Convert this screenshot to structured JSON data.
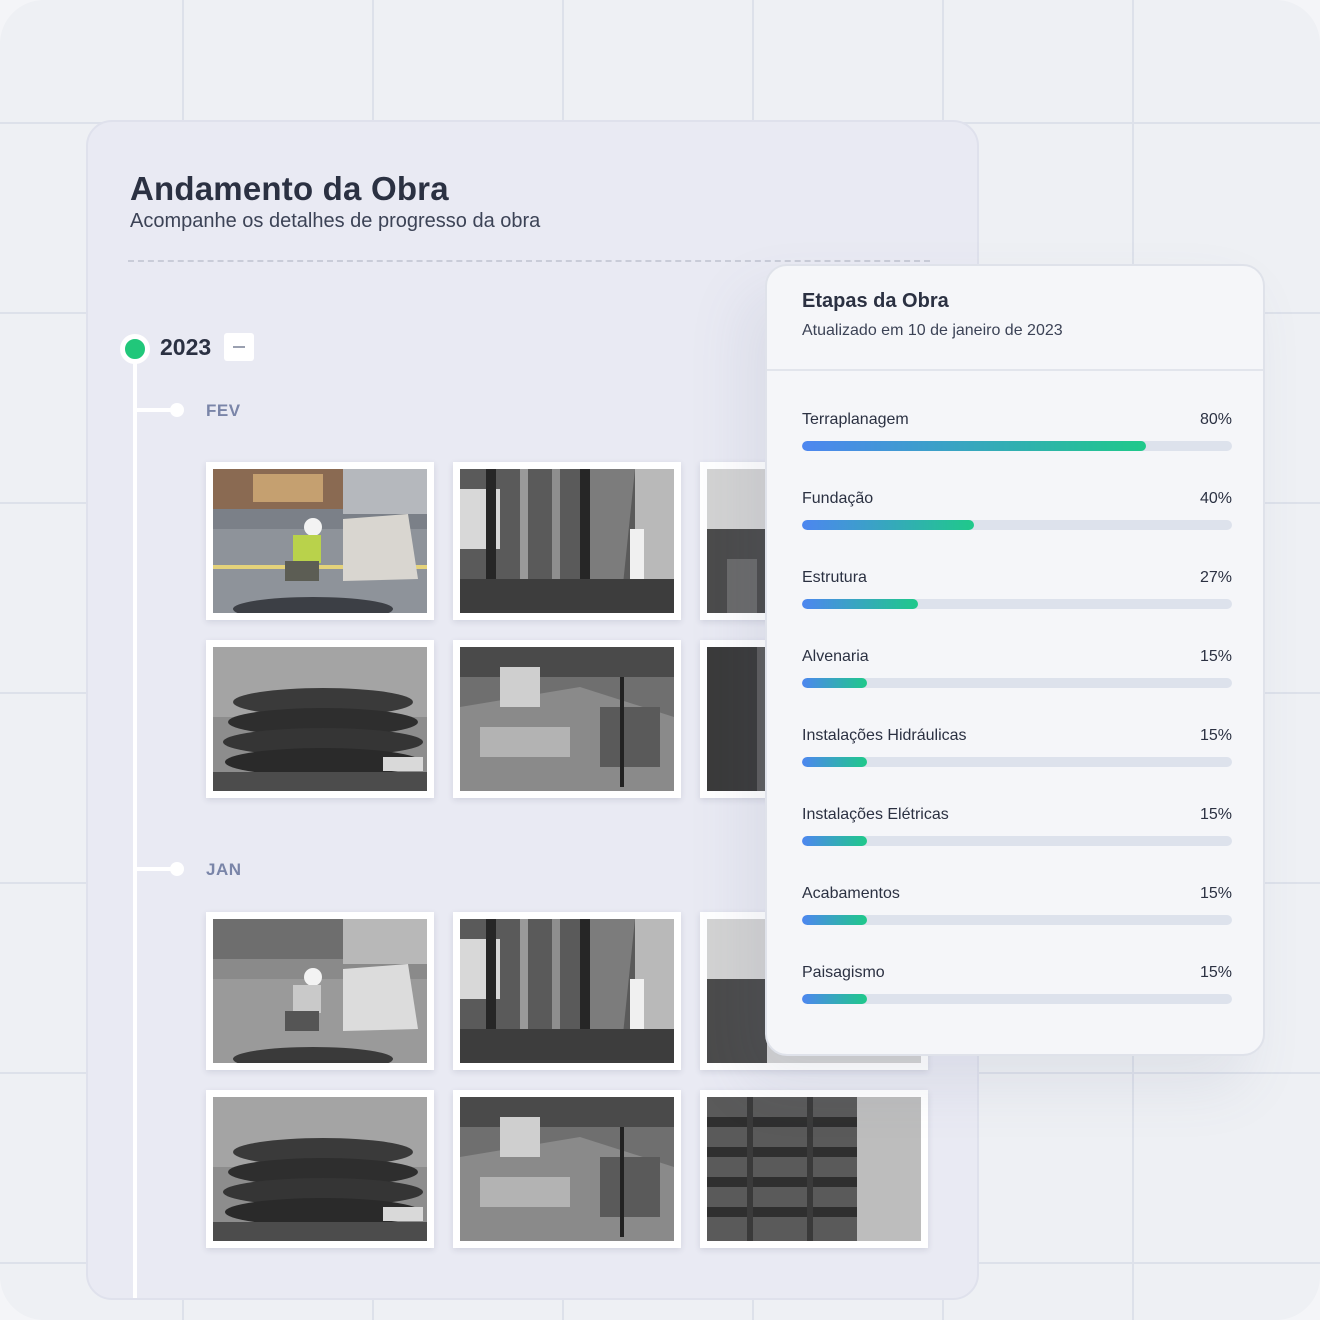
{
  "header": {
    "title": "Andamento da Obra",
    "subtitle": "Acompanhe os detalhes de progresso da obra"
  },
  "timeline": {
    "year": "2023",
    "months": [
      {
        "label": "FEV",
        "photo_count": 6
      },
      {
        "label": "JAN",
        "photo_count": 6
      }
    ]
  },
  "stages": {
    "title": "Etapas da Obra",
    "updated": "Atualizado em 10 de janeiro de 2023",
    "items": [
      {
        "name": "Terraplanagem",
        "percent_label": "80%",
        "percent": 80
      },
      {
        "name": "Fundação",
        "percent_label": "40%",
        "percent": 40
      },
      {
        "name": "Estrutura",
        "percent_label": "27%",
        "percent": 27
      },
      {
        "name": "Alvenaria",
        "percent_label": "15%",
        "percent": 15
      },
      {
        "name": "Instalações Hidráulicas",
        "percent_label": "15%",
        "percent": 15
      },
      {
        "name": "Instalações Elétricas",
        "percent_label": "15%",
        "percent": 15
      },
      {
        "name": "Acabamentos",
        "percent_label": "15%",
        "percent": 15
      },
      {
        "name": "Paisagismo",
        "percent_label": "15%",
        "percent": 15
      }
    ]
  },
  "colors": {
    "accent_green": "#21c77a",
    "bar_start": "#4d86f0",
    "bar_end": "#1fc98a"
  }
}
